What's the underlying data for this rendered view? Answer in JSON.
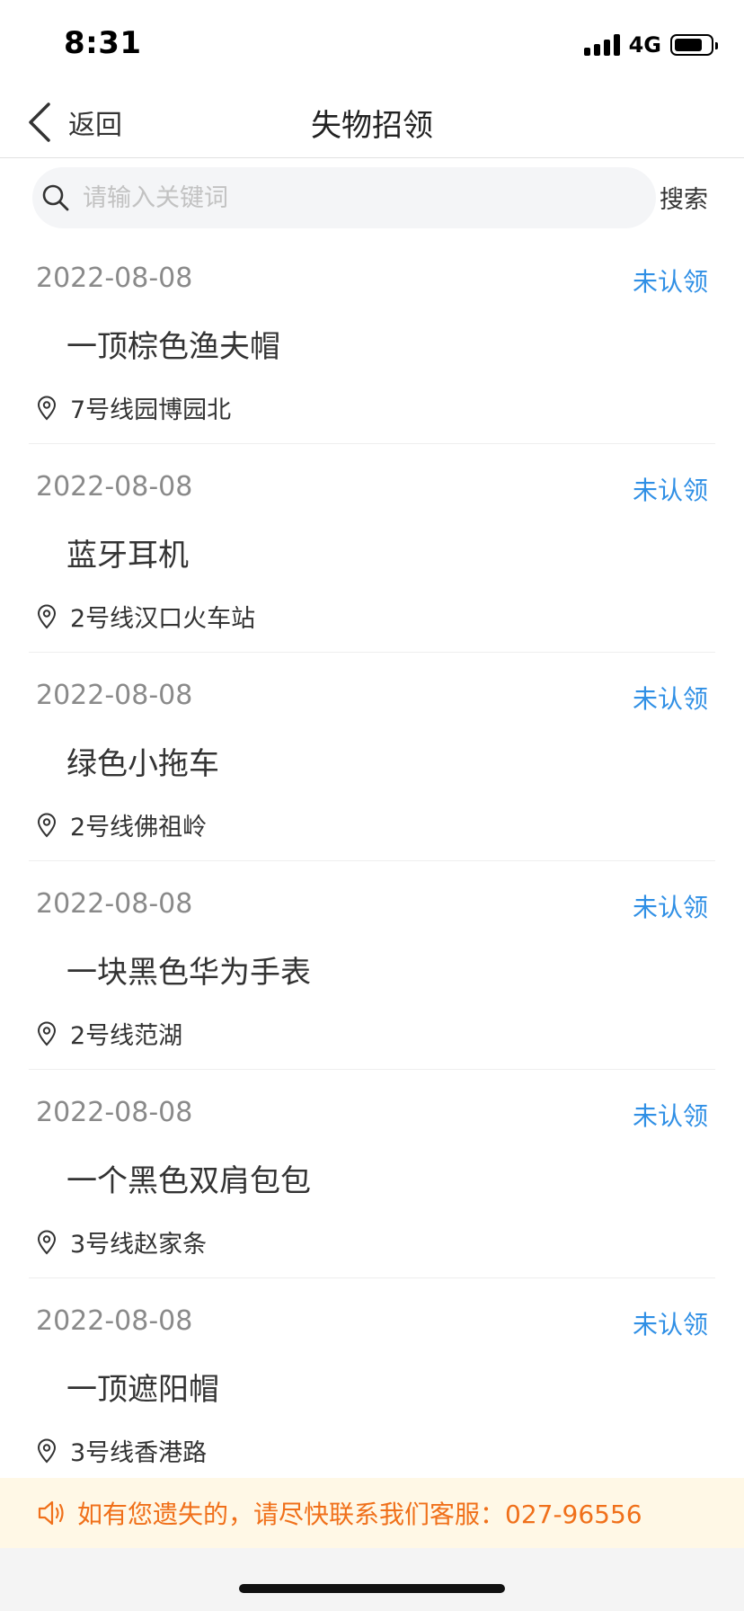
{
  "status_bar": {
    "time": "8:31",
    "network": "4G"
  },
  "nav": {
    "back_label": "返回",
    "title": "失物招领"
  },
  "search": {
    "placeholder": "请输入关键词",
    "value": "",
    "button_label": "搜索"
  },
  "items": [
    {
      "date": "2022-08-08",
      "status": "未认领",
      "title": "一顶棕色渔夫帽",
      "location": "7号线园博园北"
    },
    {
      "date": "2022-08-08",
      "status": "未认领",
      "title": "蓝牙耳机",
      "location": "2号线汉口火车站"
    },
    {
      "date": "2022-08-08",
      "status": "未认领",
      "title": "绿色小拖车",
      "location": "2号线佛祖岭"
    },
    {
      "date": "2022-08-08",
      "status": "未认领",
      "title": "一块黑色华为手表",
      "location": "2号线范湖"
    },
    {
      "date": "2022-08-08",
      "status": "未认领",
      "title": "一个黑色双肩包包",
      "location": "3号线赵家条"
    },
    {
      "date": "2022-08-08",
      "status": "未认领",
      "title": "一顶遮阳帽",
      "location": "3号线香港路"
    }
  ],
  "notice": {
    "text": "如有您遗失的，请尽快联系我们客服：027-96556"
  },
  "icons": {
    "back": "chevron-left-icon",
    "search": "search-icon",
    "location": "location-pin-icon",
    "notice": "speaker-icon"
  },
  "colors": {
    "accent": "#2f8fe5",
    "notice_text": "#f0701a",
    "notice_bg": "#fff8e6"
  }
}
